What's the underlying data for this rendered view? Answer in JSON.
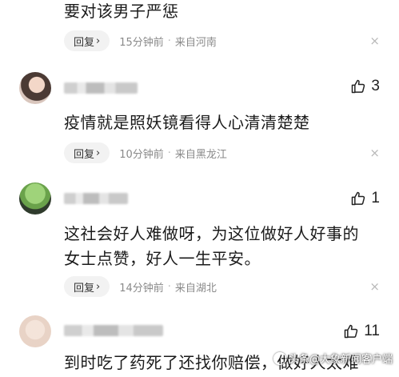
{
  "comments": [
    {
      "text": "要对该男子严惩",
      "reply_label": "回复",
      "reply_chevron": "›",
      "time": "15分钟前",
      "location": "来自河南",
      "separator": "·",
      "close_icon": "×"
    },
    {
      "likes": "3",
      "text": "疫情就是照妖镜看得人心清清楚楚",
      "reply_label": "回复",
      "reply_chevron": "›",
      "time": "10分钟前",
      "location": "来自黑龙江",
      "separator": "·",
      "close_icon": "×"
    },
    {
      "likes": "1",
      "text": "这社会好人难做呀，为这位做好人好事的女士点赞，好人一生平安。",
      "reply_label": "回复",
      "reply_chevron": "›",
      "time": "14分钟前",
      "location": "来自湖北",
      "separator": "·",
      "close_icon": "×"
    },
    {
      "likes": "11",
      "text": "到时吃了药死了还找你赔偿，做好人太难"
    }
  ],
  "watermark": "头条@大象新闻客户端",
  "icons": {
    "like": "thumb-up-icon",
    "close": "close-icon",
    "chevron": "chevron-right-icon"
  },
  "colors": {
    "meta_text": "#8a8a8a",
    "reply_bg": "#f2f2f2",
    "body_text": "#1b1b1b"
  }
}
